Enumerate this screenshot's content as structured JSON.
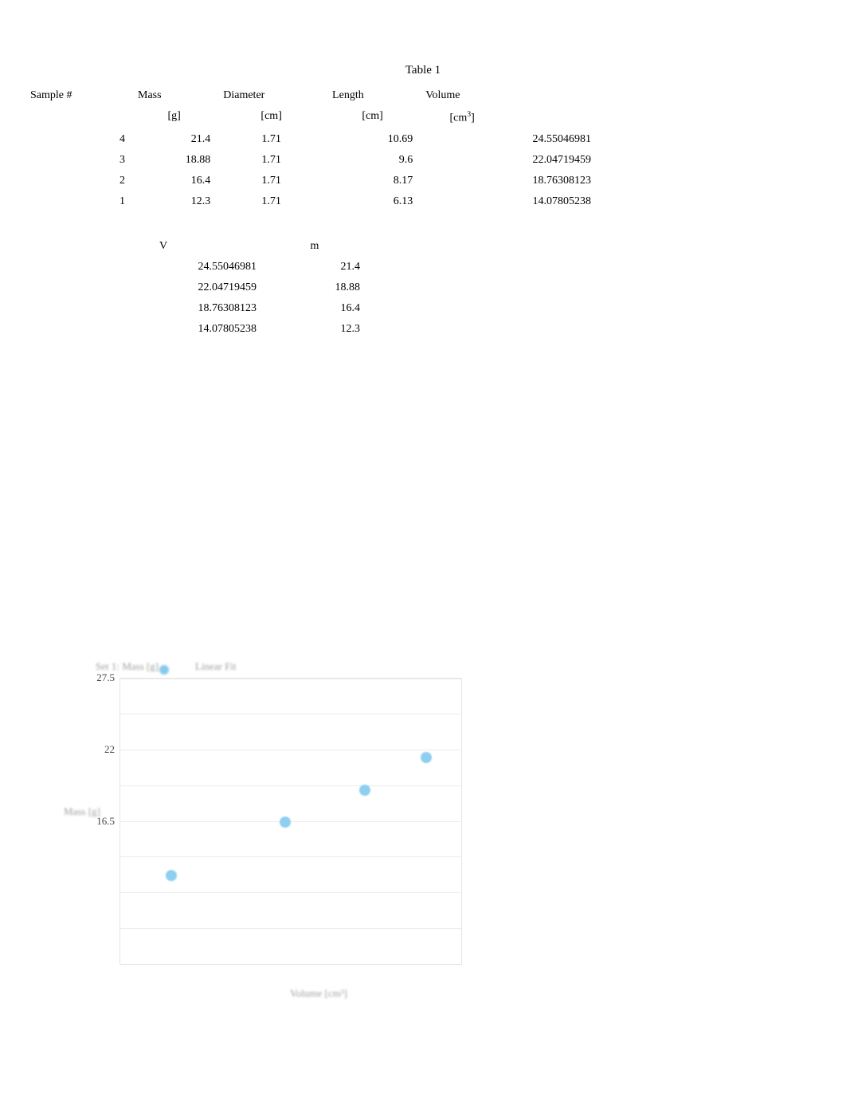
{
  "title": "Table 1",
  "table1": {
    "headers": {
      "sample": "Sample #",
      "mass": "Mass",
      "diameter": "Diameter",
      "length": "Length",
      "volume": "Volume"
    },
    "units": {
      "mass": "[g]",
      "diameter": "[cm]",
      "length": "[cm]",
      "volume_pre": "[cm",
      "volume_sup": "3",
      "volume_post": "]"
    },
    "rows": [
      {
        "sample": "4",
        "mass": "21.4",
        "diameter": "1.71",
        "length": "10.69",
        "volume": "24.55046981"
      },
      {
        "sample": "3",
        "mass": "18.88",
        "diameter": "1.71",
        "length": "9.6",
        "volume": "22.04719459"
      },
      {
        "sample": "2",
        "mass": "16.4",
        "diameter": "1.71",
        "length": "8.17",
        "volume": "18.76308123"
      },
      {
        "sample": "1",
        "mass": "12.3",
        "diameter": "1.71",
        "length": "6.13",
        "volume": "14.07805238"
      }
    ]
  },
  "table2": {
    "headers": {
      "v": "V",
      "m": "m"
    },
    "rows": [
      {
        "v": "24.55046981",
        "m": "21.4"
      },
      {
        "v": "22.04719459",
        "m": "18.88"
      },
      {
        "v": "18.76308123",
        "m": "16.4"
      },
      {
        "v": "14.07805238",
        "m": "12.3"
      }
    ]
  },
  "chart": {
    "y_ticks": [
      "27.5",
      "22",
      "16.5"
    ],
    "y_label": "Mass [g]",
    "x_label": "Volume [cm³]",
    "legend1": "Set 1: Mass [g]",
    "legend2": "Linear Fit"
  },
  "chart_data": {
    "type": "scatter",
    "title": "",
    "xlabel": "Volume [cm³]",
    "ylabel": "Mass [g]",
    "ylim": [
      5.5,
      27.5
    ],
    "xlim": [
      12,
      26
    ],
    "y_ticks": [
      27.5,
      22,
      16.5
    ],
    "series": [
      {
        "name": "Set 1: Mass [g]",
        "x": [
          14.07805238,
          18.76308123,
          22.04719459,
          24.55046981
        ],
        "y": [
          12.3,
          16.4,
          18.88,
          21.4
        ]
      }
    ]
  }
}
